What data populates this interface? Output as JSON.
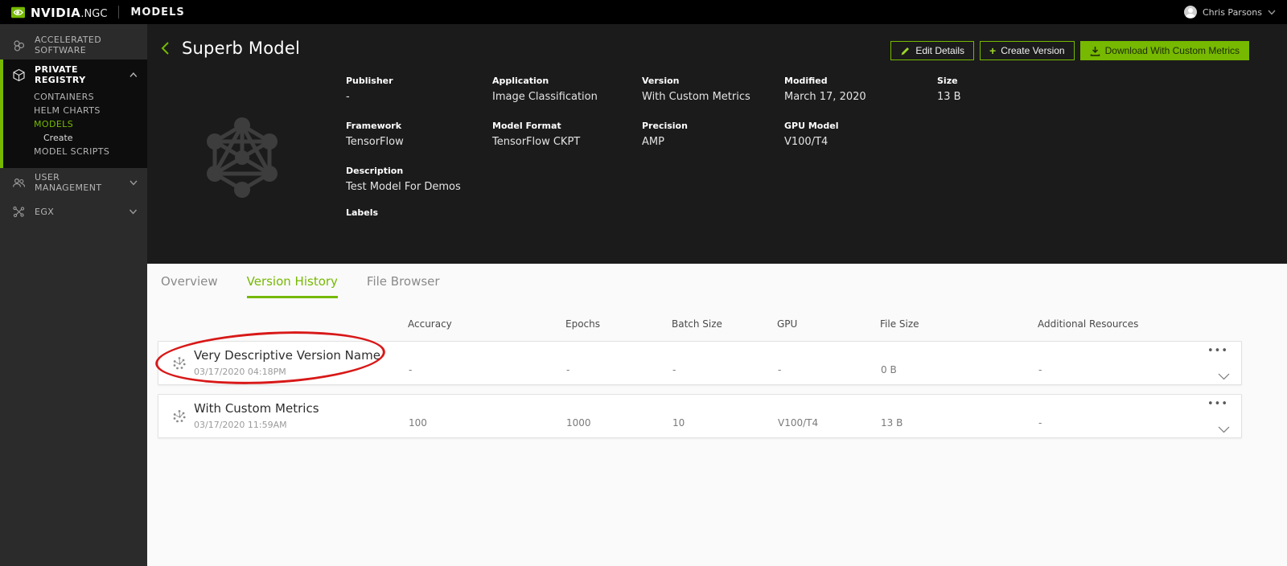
{
  "colors": {
    "accent": "#76b900",
    "annotation": "#d81818",
    "topbar_bg": "#000000",
    "sidebar_bg": "#2b2b2b",
    "main_bg": "#1b1b1b",
    "panel_bg": "#fafafa"
  },
  "topbar": {
    "brand": "NVIDIA",
    "brand_suffix": ".NGC",
    "app_title": "MODELS",
    "user_name": "Chris Parsons"
  },
  "sidebar": {
    "accelerated_software": "ACCELERATED SOFTWARE",
    "private_registry": "PRIVATE REGISTRY",
    "containers": "CONTAINERS",
    "helm_charts": "HELM CHARTS",
    "models": "MODELS",
    "create": "Create",
    "model_scripts": "MODEL SCRIPTS",
    "user_management": "USER MANAGEMENT",
    "egx": "EGX"
  },
  "header": {
    "title": "Superb Model",
    "edit_details": "Edit Details",
    "create_version": "Create Version",
    "download": "Download With Custom Metrics",
    "meta": {
      "publisher_label": "Publisher",
      "publisher": "-",
      "application_label": "Application",
      "application": "Image Classification",
      "version_label": "Version",
      "version": "With Custom Metrics",
      "modified_label": "Modified",
      "modified": "March 17, 2020",
      "size_label": "Size",
      "size": "13 B",
      "framework_label": "Framework",
      "framework": "TensorFlow",
      "model_format_label": "Model Format",
      "model_format": "TensorFlow CKPT",
      "precision_label": "Precision",
      "precision": "AMP",
      "gpu_model_label": "GPU Model",
      "gpu_model": "V100/T4",
      "description_label": "Description",
      "description": "Test Model For Demos",
      "labels_label": "Labels"
    }
  },
  "tabs": {
    "overview": "Overview",
    "version_history": "Version History",
    "file_browser": "File Browser"
  },
  "table": {
    "columns": {
      "accuracy": "Accuracy",
      "epochs": "Epochs",
      "batch_size": "Batch Size",
      "gpu": "GPU",
      "file_size": "File Size",
      "additional_resources": "Additional Resources"
    },
    "rows": [
      {
        "name": "Very Descriptive Version Name",
        "date": "03/17/2020 04:18PM",
        "accuracy": "-",
        "epochs": "-",
        "batch_size": "-",
        "gpu": "-",
        "file_size": "0 B",
        "additional_resources": "-"
      },
      {
        "name": "With Custom Metrics",
        "date": "03/17/2020 11:59AM",
        "accuracy": "100",
        "epochs": "1000",
        "batch_size": "10",
        "gpu": "V100/T4",
        "file_size": "13 B",
        "additional_resources": "-"
      }
    ]
  }
}
